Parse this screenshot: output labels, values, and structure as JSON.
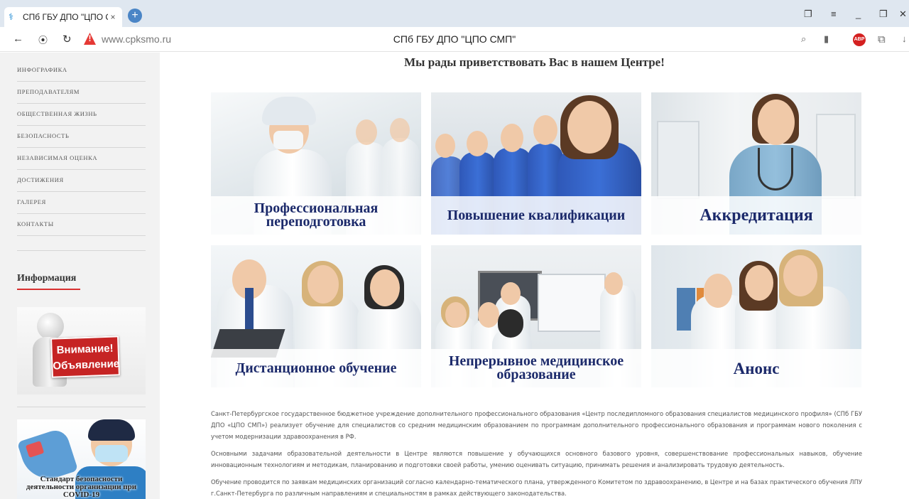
{
  "browser": {
    "tab_title": "СПб ГБУ ДПО \"ЦПО С\\",
    "tab_close": "×",
    "new_tab": "+",
    "url": "www.cpksmo.ru",
    "page_title": "СПб ГБУ ДПО \"ЦПО СМП\"",
    "abp": "ABP"
  },
  "sidebar": {
    "menu": [
      {
        "label": "ИНФОГРАФИКА"
      },
      {
        "label": "ПРЕПОДАВАТЕЛЯМ"
      },
      {
        "label": "ОБЩЕСТВЕННАЯ ЖИЗНЬ"
      },
      {
        "label": "БЕЗОПАСНОСТЬ"
      },
      {
        "label": "НЕЗАВИСИМАЯ ОЦЕНКА"
      },
      {
        "label": "ДОСТИЖЕНИЯ"
      },
      {
        "label": "ГАЛЕРЕЯ"
      },
      {
        "label": "КОНТАКТЫ"
      }
    ],
    "info_heading": "Информация",
    "banner1": {
      "line1": "Внимание!",
      "line2": "Объявление"
    },
    "banner2": {
      "text": "Стандарт безопасности деятельности организации при COVID-19"
    }
  },
  "main": {
    "welcome": "Мы рады приветствовать Вас в нашем Центре!",
    "tiles": [
      {
        "caption": "Профессиональная переподготовка"
      },
      {
        "caption": "Повышение квалификации"
      },
      {
        "caption": "Аккредитация"
      },
      {
        "caption": "Дистанционное обучение"
      },
      {
        "caption": "Непрерывное медицинское образование"
      },
      {
        "caption": "Анонс"
      }
    ],
    "paragraphs": [
      "Санкт-Петербургское государственное бюджетное учреждение дополнительного профессионального образования «Центр последипломного образования специалистов медицинского профиля» (СПб ГБУ ДПО «ЦПО СМП») реализует обучение для специалистов со средним медицинским образованием по программам дополнительного профессионального образования и программам нового поколения с учетом модернизации здравоохранения в РФ.",
      "Основными задачами образовательной деятельности в Центре являются повышение у обучающихся основного базового уровня, совершенствование профессиональных навыков, обучение инновационным технологиям и методикам, планированию и подготовки своей работы, умению оценивать ситуацию, принимать решения и анализировать трудовую деятельность.",
      "Обучение проводится по заявкам медицинских организаций согласно календарно-тематического плана, утвержденного Комитетом по здравоохранению, в Центре и на базах практического обучения ЛПУ г.Санкт-Петербурга по различным направлениям и специальностям в рамках действующего законодательства."
    ]
  }
}
